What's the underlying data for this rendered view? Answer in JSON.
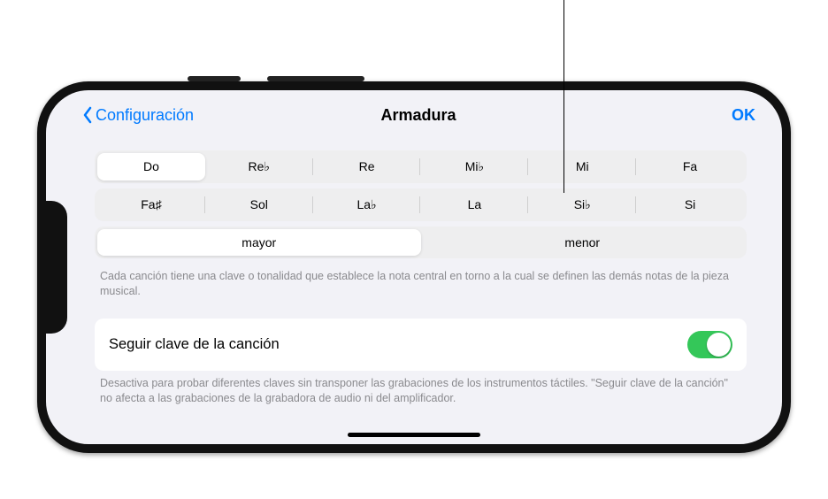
{
  "nav": {
    "back_label": "Configuración",
    "title": "Armadura",
    "ok_label": "OK"
  },
  "keys": {
    "row1": [
      "Do",
      "Re♭",
      "Re",
      "Mi♭",
      "Mi",
      "Fa"
    ],
    "row2": [
      "Fa♯",
      "Sol",
      "La♭",
      "La",
      "Si♭",
      "Si"
    ],
    "selected_key": "Do"
  },
  "scale": {
    "options": [
      "mayor",
      "menor"
    ],
    "selected": "mayor"
  },
  "helper_text_1": "Cada canción tiene una clave o tonalidad que establece la nota central en torno a la cual se definen las demás notas de la pieza musical.",
  "follow_cell": {
    "label": "Seguir clave de la canción",
    "enabled": true
  },
  "helper_text_2": "Desactiva para probar diferentes claves sin transponer las grabaciones de los instrumentos táctiles. \"Seguir clave de la canción\" no afecta a las grabaciones de la grabadora de audio ni del amplificador."
}
